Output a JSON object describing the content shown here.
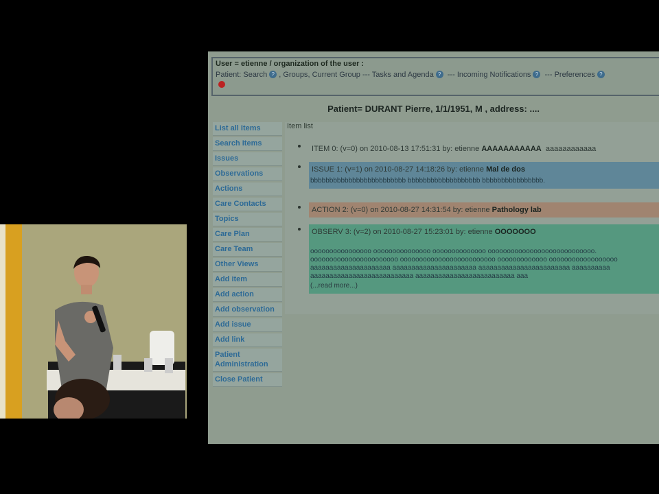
{
  "header": {
    "user_line": "User = etienne / organization of the user :",
    "nav": {
      "prefix": "Patient:",
      "search": "Search",
      "groups": "Groups",
      "current_group": "Current Group",
      "sep1": "---",
      "tasks": "Tasks and Agenda",
      "sep2": "---",
      "notifications": "Incoming Notifications",
      "sep3": "---",
      "preferences": "Preferences"
    }
  },
  "patient_title": "Patient= DURANT Pierre, 1/1/1951, M , address: ....",
  "sidebar": {
    "items": [
      "List all Items",
      "Search Items",
      "Issues",
      "Observations",
      "Actions",
      "Care Contacts",
      "Topics",
      "Care Plan",
      "Care Team",
      "Other Views",
      "Add item",
      "Add action",
      "Add observation",
      "Add issue",
      "Add link",
      "Patient Administration",
      "Close Patient"
    ]
  },
  "content": {
    "label": "Item list",
    "items": [
      {
        "head": "ITEM 0: (v=0) on 2010-08-13 17:51:31 by: etienne",
        "title": "AAAAAAAAAAA",
        "extra": "aaaaaaaaaaaa",
        "color": "#93a096"
      },
      {
        "head": "ISSUE 1: (v=1) on 2010-08-27 14:18:26 by: etienne",
        "title": "Mal de dos",
        "body": "bbbbbbbbbbbbbbbbbbbbbbbbb bbbbbbbbbbbbbbbbbbb bbbbbbbbbbbbbbbb.",
        "color": "#5f8698"
      },
      {
        "head": "ACTION 2: (v=0) on 2010-08-27 14:31:54 by: etienne",
        "title": "Pathology lab",
        "color": "#a08470"
      },
      {
        "head": "OBSERV 3: (v=2) on 2010-08-27 15:23:01 by: etienne",
        "title": "OOOOOOO",
        "body": "oooooooooooooooo ooooooooooooooo oooooooooooooo oooooooooooooooooooooooooooo. ooooooooooooooooooooooo ooooooooooooooooooooooooo ooooooooooooo oooooooooooooooooo aaaaaaaaaaaaaaaaaaaaa aaaaaaaaaaaaaaaaaaaaaa aaaaaaaaaaaaaaaaaaaaaaaa aaaaaaaaaa aaaaaaaaaaaaaaaaaaaaaaaaaaa aaaaaaaaaaaaaaaaaaaaaaaaaa aaa",
        "more": "(...read more...)",
        "color": "#55987f"
      }
    ]
  },
  "colors": {
    "background": "#000000",
    "screen": "#8f9c8f",
    "link": "#2d6a96"
  },
  "icons": {
    "help": "help-circle-icon",
    "logout": "red-dot-icon",
    "cursor": "hand-cursor-icon"
  }
}
